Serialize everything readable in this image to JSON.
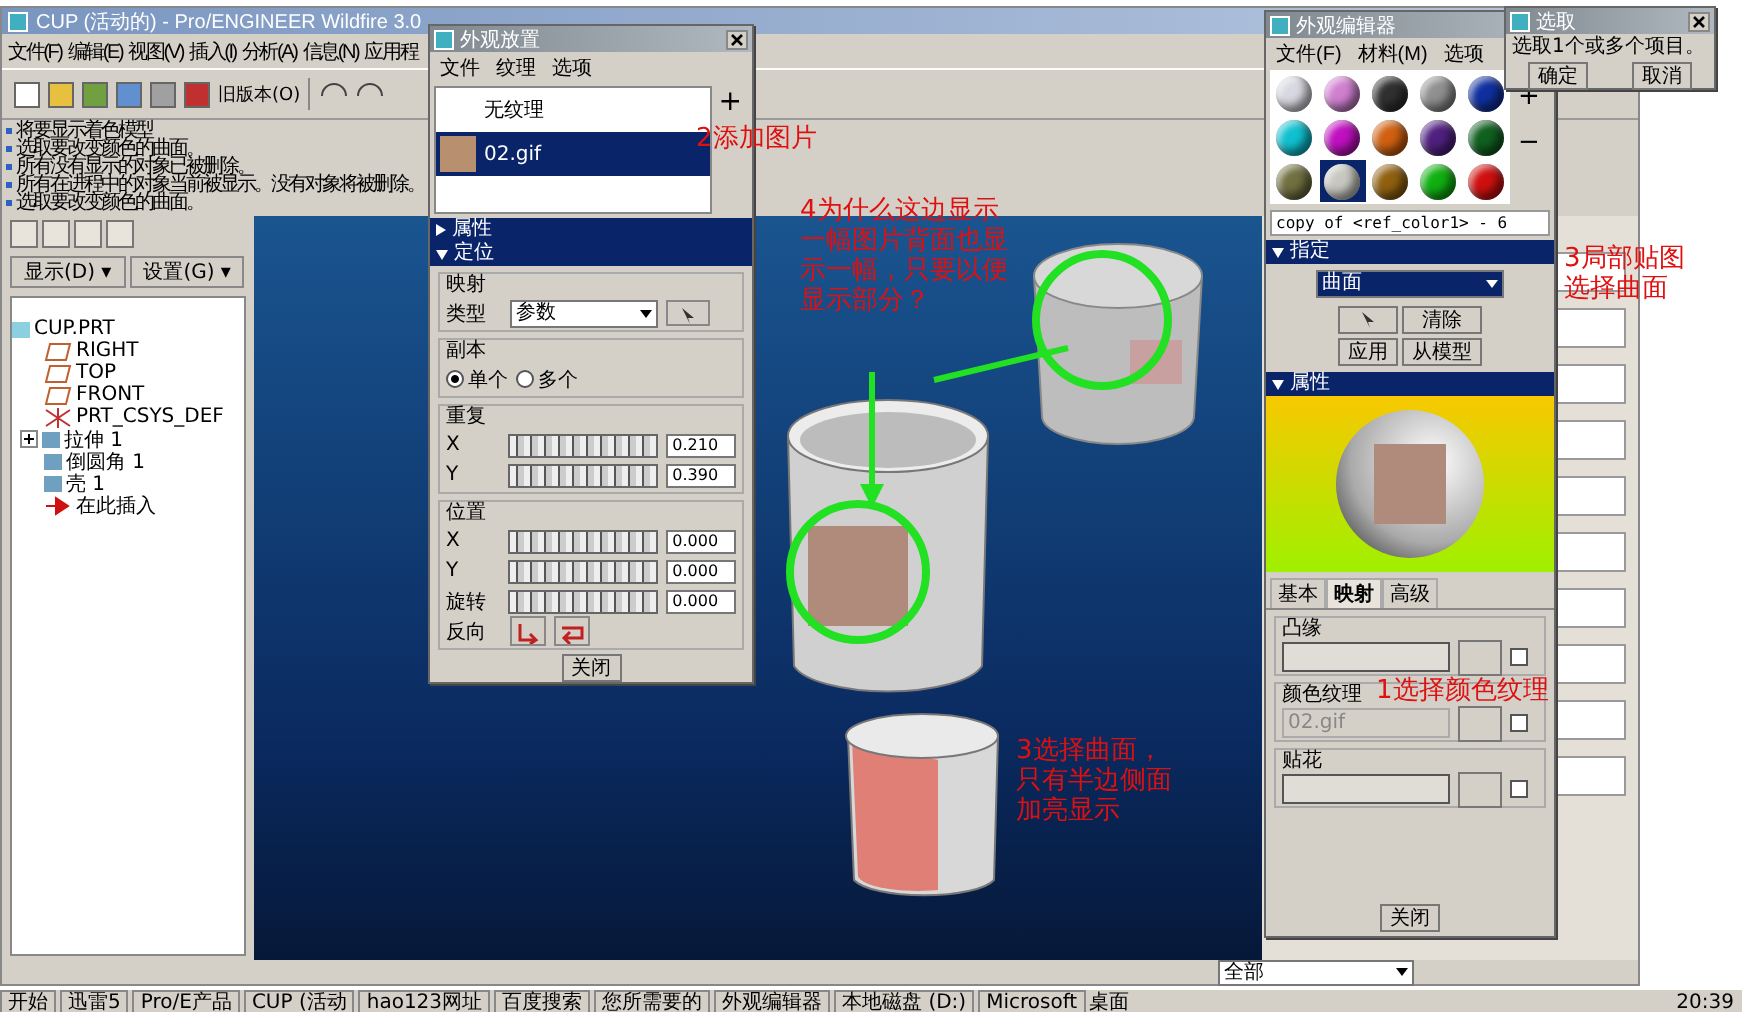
{
  "window": {
    "title": "CUP (活动的) - Pro/ENGINEER Wildfire 3.0"
  },
  "menu": [
    "文件(F)",
    "编辑(E)",
    "视图(V)",
    "插入(I)",
    "分析(A)",
    "信息(N)",
    "应用程"
  ],
  "toolbar": {
    "legacy_button": "旧版本(O)"
  },
  "messages": [
    "将要显示着色模型",
    "选取要改变颜色的曲面。",
    "所有没有显示的对象已被删除。",
    "所有在进程中的对象当前被显示。没有对象将被删除。",
    "选取要改变颜色的曲面。"
  ],
  "navigator": {
    "dropdowns": [
      "显示(D) ▾",
      "设置(G) ▾"
    ],
    "tree": {
      "label": "CUP.PRT",
      "kind": "part",
      "children": [
        {
          "label": "RIGHT",
          "kind": "plane"
        },
        {
          "label": "TOP",
          "kind": "plane"
        },
        {
          "label": "FRONT",
          "kind": "plane"
        },
        {
          "label": "PRT_CSYS_DEF",
          "kind": "csys"
        },
        {
          "label": "拉伸 1",
          "kind": "feature",
          "expanded": false
        },
        {
          "label": "倒圆角 1",
          "kind": "feature"
        },
        {
          "label": "壳 1",
          "kind": "feature"
        },
        {
          "label": "在此插入",
          "kind": "insert"
        }
      ]
    }
  },
  "placement_dialog": {
    "title": "外观放置",
    "menu": [
      "文件",
      "纹理",
      "选项"
    ],
    "textures": [
      {
        "label": "无纹理",
        "selected": false,
        "kind": "none"
      },
      {
        "label": "02.gif",
        "selected": true,
        "kind": "image"
      }
    ],
    "add_button": "+",
    "sections": [
      {
        "label": "属性",
        "expanded": false
      },
      {
        "label": "定位",
        "expanded": true
      }
    ],
    "mapping": {
      "title": "映射",
      "type_label": "类型",
      "type_value": "参数"
    },
    "copies": {
      "title": "副本",
      "options": [
        {
          "label": "单个",
          "selected": true
        },
        {
          "label": "多个",
          "selected": false
        }
      ]
    },
    "repeat": {
      "title": "重复",
      "rows": [
        {
          "label": "X",
          "value": "0.210"
        },
        {
          "label": "Y",
          "value": "0.390"
        }
      ]
    },
    "position": {
      "title": "位置",
      "rows": [
        {
          "label": "X",
          "value": "0.000"
        },
        {
          "label": "Y",
          "value": "0.000"
        },
        {
          "label": "旋转",
          "value": "0.000"
        }
      ],
      "flip_label": "反向"
    },
    "close_button": "关闭"
  },
  "appearance_editor": {
    "title": "外观编辑器",
    "menu": [
      "文件(F)",
      "材料(M)",
      "选项"
    ],
    "swatches": [
      {
        "color": "#d8d8e0",
        "selected": false
      },
      {
        "color": "#d080d0",
        "selected": false
      },
      {
        "color": "#303030",
        "selected": false
      },
      {
        "color": "#909090",
        "selected": false
      },
      {
        "color": "#1030a0",
        "selected": false
      },
      {
        "color": "#10c0d0",
        "selected": false
      },
      {
        "color": "#c010c0",
        "selected": false
      },
      {
        "color": "#d06010",
        "selected": false
      },
      {
        "color": "#502080",
        "selected": false
      },
      {
        "color": "#106020",
        "selected": false
      },
      {
        "color": "#707040",
        "selected": false
      },
      {
        "color": "#c8c8c0",
        "selected": true
      },
      {
        "color": "#906010",
        "selected": false
      },
      {
        "color": "#10b010",
        "selected": false
      },
      {
        "color": "#d01010",
        "selected": false
      }
    ],
    "zoom_buttons": [
      "+",
      "−"
    ],
    "name_field": "copy of <ref_color1> - 6",
    "assign": {
      "label": "指定",
      "select_value": "曲面",
      "buttons": [
        "清除",
        "应用",
        "从模型"
      ]
    },
    "properties_label": "属性",
    "tabs": [
      {
        "label": "基本",
        "selected": false
      },
      {
        "label": "映射",
        "selected": true
      },
      {
        "label": "高级",
        "selected": false
      }
    ],
    "maps": [
      {
        "label": "凸缘",
        "disabled": false,
        "checked": false
      },
      {
        "label": "颜色纹理",
        "value": "02.gif",
        "disabled": true,
        "checked": false
      },
      {
        "label": "贴花",
        "disabled": false,
        "checked": false
      }
    ],
    "close_button": "关闭"
  },
  "select_dialog": {
    "title": "选取",
    "message": "选取1个或多个项目。",
    "buttons": [
      "确定",
      "取消"
    ]
  },
  "annotations": [
    {
      "text": "2添加图片",
      "kind": "add"
    },
    {
      "text": "4为什么这边显示一幅图片背面也显示一幅，只要以便显示部分？",
      "kind": "question"
    },
    {
      "text": "3局部贴图选择曲面",
      "kind": "surface"
    },
    {
      "text": "1选择颜色纹理",
      "kind": "texture"
    },
    {
      "text": "3选择曲面，只有半边侧面加亮显示",
      "kind": "highlight"
    }
  ],
  "status_bar": {
    "filter": "全部"
  },
  "taskbar": {
    "start": "开始",
    "items": [
      "迅雷5",
      "Pro/E产品",
      "CUP (活动",
      "hao123网址",
      "百度搜索",
      "您所需要的",
      "外观编辑器",
      "本地磁盘 (D:)",
      "Microsoft"
    ],
    "tray_label": "桌面",
    "clock": "20:39"
  }
}
